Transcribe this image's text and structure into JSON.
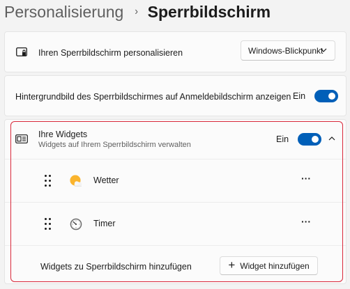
{
  "breadcrumb": {
    "parent": "Personalisierung",
    "separator": "›",
    "current": "Sperrbildschirm"
  },
  "lock_screen_row": {
    "icon": "lock-screen-icon",
    "label": "Ihren Sperrbildschirm personalisieren",
    "dropdown_value": "Windows-Blickpunkt"
  },
  "signin_background_row": {
    "label": "Hintergrundbild des Sperrbildschirmes auf Anmeldebildschirm anzeigen",
    "toggle_label": "Ein",
    "toggle_on": true
  },
  "widgets": {
    "icon": "widgets-icon",
    "title": "Ihre Widgets",
    "subtitle": "Widgets auf Ihrem Sperrbildschirm verwalten",
    "toggle_label": "Ein",
    "toggle_on": true,
    "expanded": true,
    "items": [
      {
        "label": "Wetter",
        "icon": "weather-icon",
        "more": "···"
      },
      {
        "label": "Timer",
        "icon": "timer-icon",
        "more": "···"
      }
    ],
    "add_label": "Widgets zu Sperrbildschirm hinzufügen",
    "add_button": "Widget hinzufügen"
  },
  "colors": {
    "accent": "#005fb8",
    "highlight_border": "#d9283a",
    "background": "#f3f3f3",
    "card": "#fbfbfb"
  }
}
